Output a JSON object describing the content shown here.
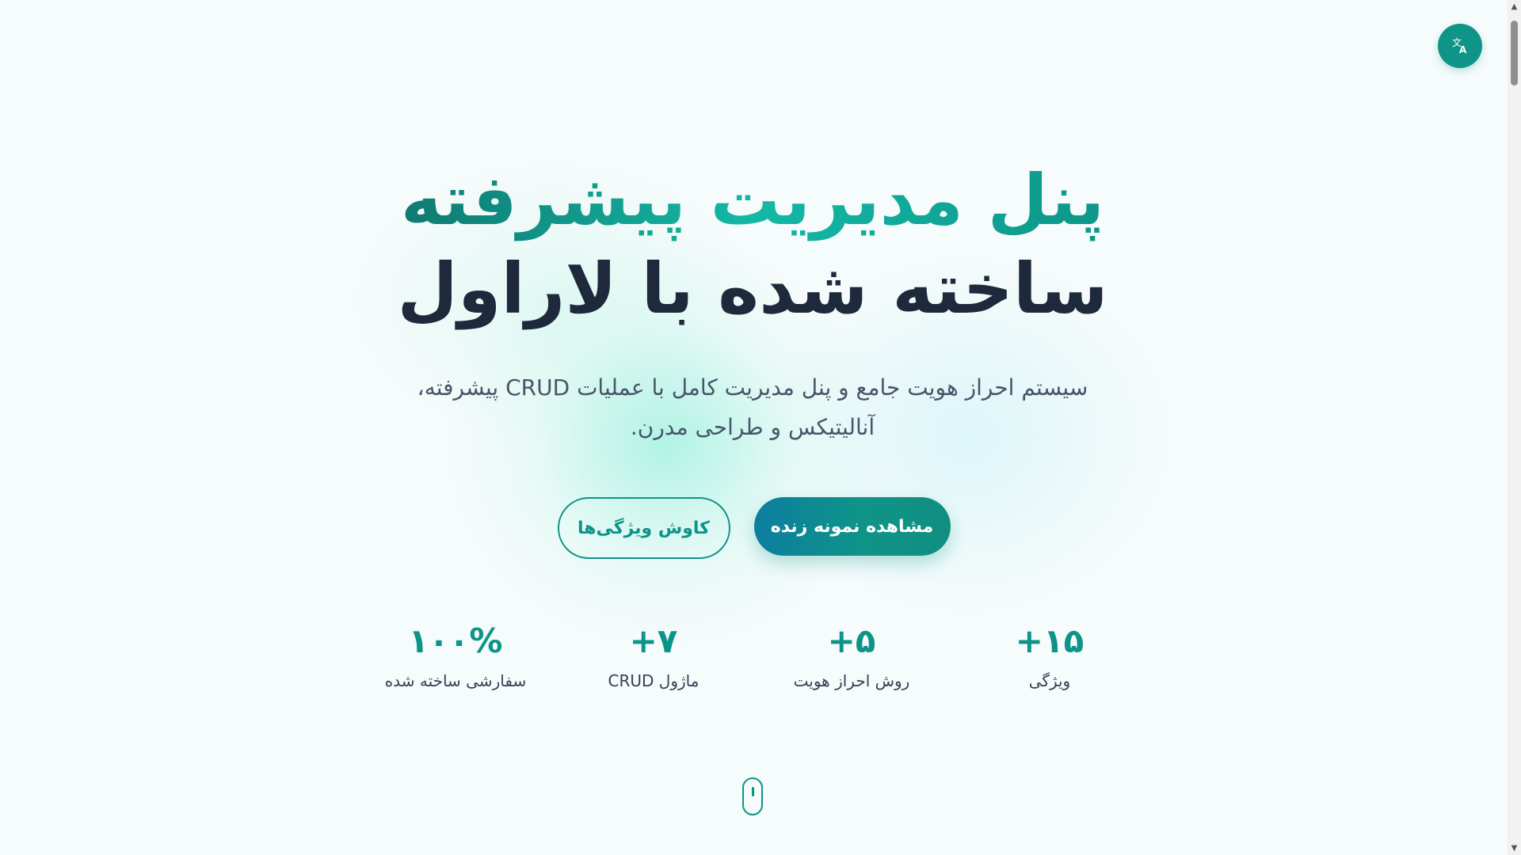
{
  "header": {
    "language_button_icon": "translate-icon"
  },
  "hero": {
    "title_line1": "پنل مدیریت پیشرفته",
    "title_line2": "ساخته شده با لاراول",
    "subtitle_line1": "سیستم احراز هویت جامع و پنل مدیریت کامل با عملیات CRUD پیشرفته،",
    "subtitle_line2": "آنالیتیکس و طراحی مدرن."
  },
  "actions": {
    "primary_label": "مشاهده نمونه زنده",
    "secondary_label": "کاوش ویژگی‌ها"
  },
  "stats": [
    {
      "value": "+۱۵",
      "label": "ویژگی"
    },
    {
      "value": "+۵",
      "label": "روش احراز هویت"
    },
    {
      "value": "+۷",
      "label": "ماژول CRUD"
    },
    {
      "value": "۱۰۰%",
      "label": "سفارشی ساخته شده"
    }
  ],
  "colors": {
    "accent": "#0d9488",
    "dark_text": "#1e293b",
    "background": "#f6fbfb"
  },
  "scroll_indicator_icon": "mouse-scroll-icon"
}
